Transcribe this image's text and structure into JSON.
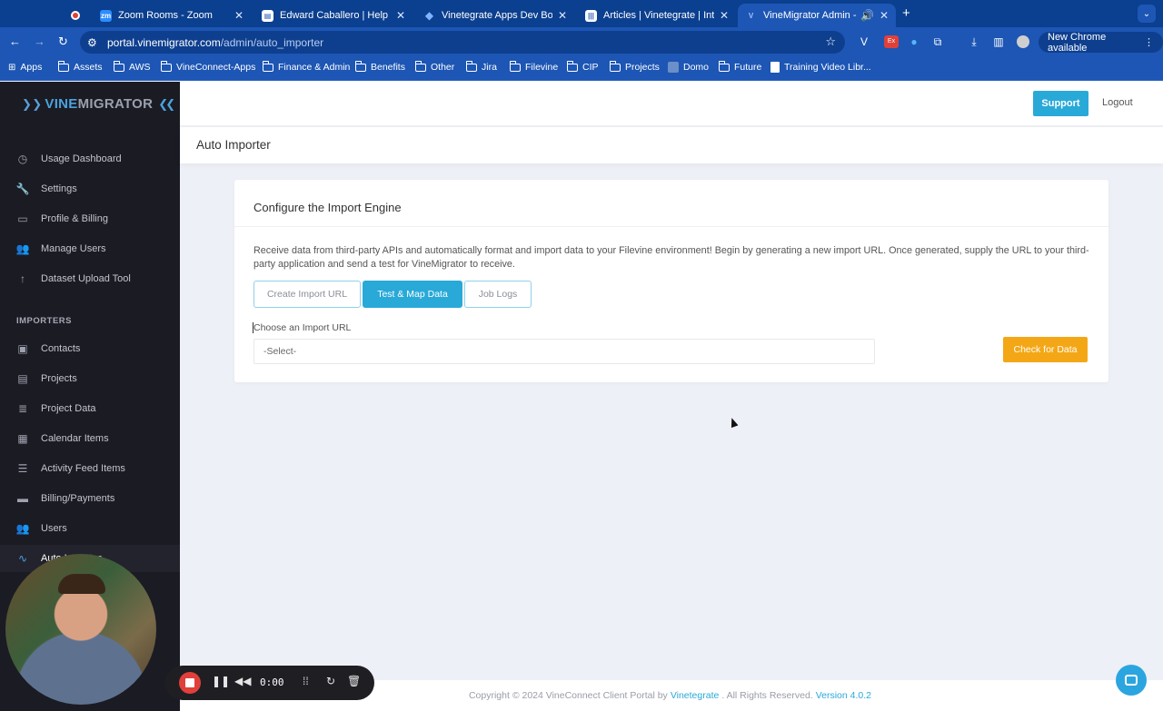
{
  "browser": {
    "tabs": [
      {
        "title": "",
        "active": false
      },
      {
        "title": "Zoom Rooms - Zoom",
        "active": false
      },
      {
        "title": "Edward Caballero | Help Desk -",
        "active": false
      },
      {
        "title": "Vinetegrate Apps Dev Board -",
        "active": false
      },
      {
        "title": "Articles | Vinetegrate | Interco",
        "active": false
      },
      {
        "title": "VineMigrator Admin - Auto",
        "active": true
      }
    ],
    "url_host": "portal.vinemigrator.com",
    "url_path": "/admin/auto_importer",
    "new_chrome_label": "New Chrome available",
    "ext_badge": "Ex",
    "bookmarks": [
      "Apps",
      "Assets",
      "AWS",
      "VineConnect-Apps",
      "Finance & Admin",
      "Benefits",
      "Other",
      "Jira",
      "Filevine",
      "CIP",
      "Projects",
      "Domo",
      "Future",
      "Training Video Libr..."
    ]
  },
  "sidebar": {
    "logo_vine": "VINE",
    "logo_migrator": "MIGRATOR",
    "items": [
      {
        "label": "Usage Dashboard",
        "icon": "clock-icon"
      },
      {
        "label": "Settings",
        "icon": "wrench-icon"
      },
      {
        "label": "Profile & Billing",
        "icon": "id-card-icon"
      },
      {
        "label": "Manage Users",
        "icon": "users-icon"
      },
      {
        "label": "Dataset Upload Tool",
        "icon": "arrow-up-icon"
      }
    ],
    "section_label": "IMPORTERS",
    "importers": [
      {
        "label": "Contacts",
        "icon": "contact-card-icon"
      },
      {
        "label": "Projects",
        "icon": "folder-icon"
      },
      {
        "label": "Project Data",
        "icon": "database-icon"
      },
      {
        "label": "Calendar Items",
        "icon": "calendar-icon"
      },
      {
        "label": "Activity Feed Items",
        "icon": "list-icon"
      },
      {
        "label": "Billing/Payments",
        "icon": "credit-card-icon"
      },
      {
        "label": "Users",
        "icon": "users-icon"
      },
      {
        "label": "Auto Importer",
        "icon": "pulse-icon"
      }
    ]
  },
  "header": {
    "support_label": "Support",
    "logout_label": "Logout",
    "page_title": "Auto Importer"
  },
  "card": {
    "title": "Configure the Import Engine",
    "description": "Receive data from third-party APIs and automatically format and import data to your Filevine environment! Begin by generating a new import URL. Once generated, supply the URL to your third-party application and send a test for VineMigrator to receive.",
    "tabs": [
      {
        "label": "Create Import URL",
        "active": false
      },
      {
        "label": "Test & Map Data",
        "active": true
      },
      {
        "label": "Job Logs",
        "active": false
      }
    ],
    "field_label": "Choose an Import URL",
    "select_value": "-Select-",
    "check_label": "Check for Data"
  },
  "footer": {
    "prefix": "Copyright © 2024 VineConnect Client Portal by",
    "company": "Vinetegrate",
    "suffix": ". All Rights Reserved.",
    "version": "Version 4.0.2"
  },
  "recorder": {
    "time": "0:00"
  },
  "colors": {
    "accent": "#29a9d8",
    "warning": "#f4a716",
    "sidebar_bg": "#1b1b23",
    "chrome_blue": "#1d56b4"
  }
}
